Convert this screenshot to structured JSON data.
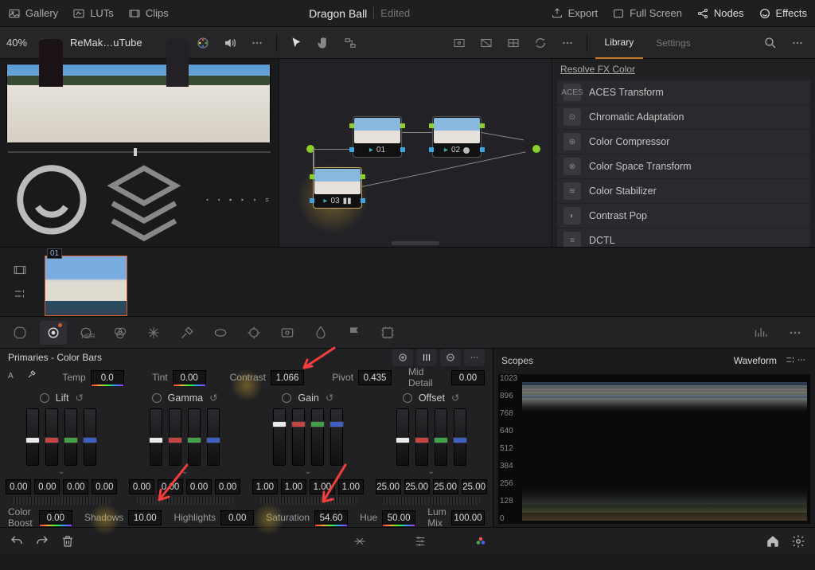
{
  "topbar": {
    "gallery": "Gallery",
    "luts": "LUTs",
    "clips": "Clips",
    "title": "Dragon Ball",
    "status": "Edited",
    "export": "Export",
    "fullscreen": "Full Screen",
    "nodes": "Nodes",
    "effects": "Effects"
  },
  "bar2": {
    "zoom": "40%",
    "clipname": "ReMak…uTube",
    "library": "Library",
    "settings": "Settings"
  },
  "fxpanel": {
    "header": "Resolve FX Color",
    "items": [
      {
        "label": "ACES Transform",
        "badge": "ACES"
      },
      {
        "label": "Chromatic Adaptation",
        "badge": "⊙"
      },
      {
        "label": "Color Compressor",
        "badge": "⊕"
      },
      {
        "label": "Color Space Transform",
        "badge": "⊗"
      },
      {
        "label": "Color Stabilizer",
        "badge": "≋"
      },
      {
        "label": "Contrast Pop",
        "badge": "◐"
      },
      {
        "label": "DCTL",
        "badge": "≡"
      }
    ]
  },
  "nodes": {
    "n1": "01",
    "n2": "02",
    "n3": "03"
  },
  "tl": {
    "clip_tag": "01"
  },
  "primaries": {
    "title": "Primaries - Color Bars",
    "temp_label": "Temp",
    "temp_value": "0.0",
    "tint_label": "Tint",
    "tint_value": "0.00",
    "contrast_label": "Contrast",
    "contrast_value": "1.066",
    "pivot_label": "Pivot",
    "pivot_value": "0.435",
    "middetail_label": "Mid Detail",
    "middetail_value": "0.00",
    "wheels": {
      "lift": {
        "label": "Lift",
        "nums": [
          "0.00",
          "0.00",
          "0.00",
          "0.00"
        ],
        "knob": 50
      },
      "gamma": {
        "label": "Gamma",
        "nums": [
          "0.00",
          "0.00",
          "0.00",
          "0.00"
        ],
        "knob": 50
      },
      "gain": {
        "label": "Gain",
        "nums": [
          "1.00",
          "1.00",
          "1.00",
          "1.00"
        ],
        "knob": 22
      },
      "offset": {
        "label": "Offset",
        "nums": [
          "25.00",
          "25.00",
          "25.00",
          "25.00"
        ],
        "knob": 50
      }
    },
    "row3": {
      "colorboost_label": "Color Boost",
      "colorboost_value": "0.00",
      "shadows_label": "Shadows",
      "shadows_value": "10.00",
      "highlights_label": "Highlights",
      "highlights_value": "0.00",
      "saturation_label": "Saturation",
      "saturation_value": "54.60",
      "hue_label": "Hue",
      "hue_value": "50.00",
      "lummix_label": "Lum Mix",
      "lummix_value": "100.00"
    }
  },
  "scopes": {
    "title": "Scopes",
    "mode": "Waveform",
    "ticks": [
      "1023",
      "896",
      "768",
      "640",
      "512",
      "384",
      "256",
      "128",
      "0"
    ]
  }
}
